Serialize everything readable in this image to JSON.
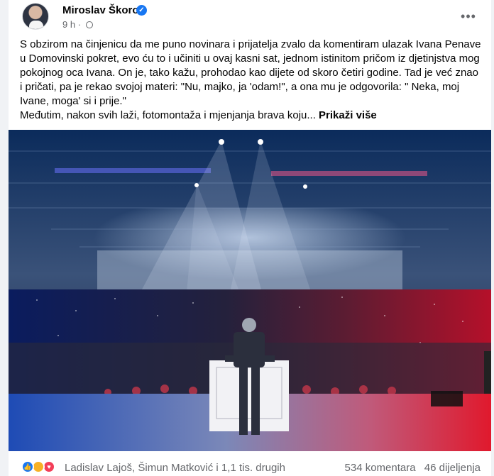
{
  "post": {
    "author": "Miroslav Škoro",
    "time": "9 h",
    "separator": "·",
    "text": "S obzirom na činjenicu da me puno novinara i prijatelja zvalo da komentiram ulazak Ivana Penave u Domovinski pokret, evo ću to i učiniti u ovaj kasni sat, jednom istinitom pričom iz djetinjstva mog pokojnog oca Ivana. On je, tako kažu, prohodao kao dijete od skoro četiri godine. Tad je već znao i pričati, pa je rekao svojoj materi: \"Nu, majko, ja 'odam!\", a ona mu je odgovorila: \" Neka, moj Ivane, moga' si i prije.\"",
    "text_line2": "Međutim, nakon svih laži, fotomontaža i mjenjanja brava koju...",
    "see_more": "Prikaži više"
  },
  "footer": {
    "reactors": "Ladislav Lajoš, Šimun Matković i 1,1 tis. drugih",
    "comments": "534 komentara",
    "shares": "46 dijeljenja"
  },
  "icons": {
    "more": "more-options-icon",
    "verified": "verified-badge-icon",
    "audience": "globe-icon",
    "reactions": [
      "like-reaction-icon",
      "care-reaction-icon",
      "love-reaction-icon"
    ]
  },
  "colors": {
    "verified": "#1877f2",
    "like": "#1877f2",
    "care": "#f7b125",
    "love": "#f33e58"
  }
}
